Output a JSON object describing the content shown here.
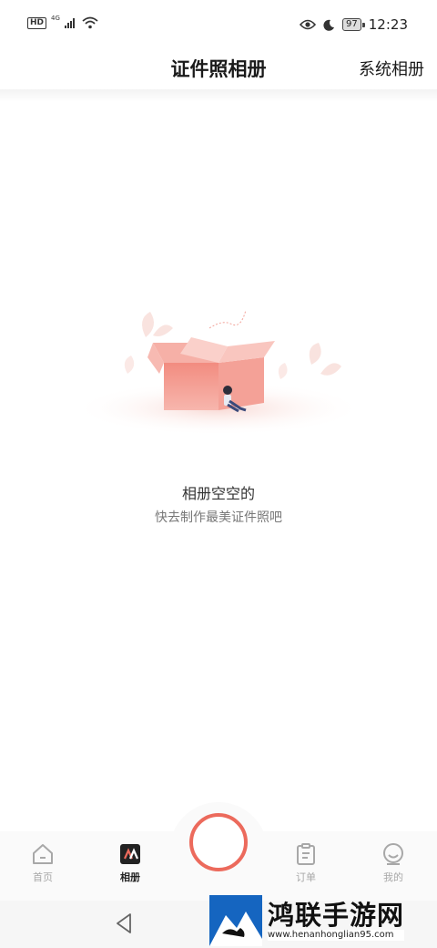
{
  "status_bar": {
    "left_badge": "HD",
    "network": "4G",
    "battery": "97",
    "time": "12:23"
  },
  "header": {
    "title": "证件照相册",
    "right_action": "系统相册"
  },
  "empty_state": {
    "title": "相册空空的",
    "subtitle": "快去制作最美证件照吧"
  },
  "bottom_nav": {
    "items": [
      {
        "label": "首页",
        "icon": "home-icon",
        "active": false
      },
      {
        "label": "相册",
        "icon": "album-icon",
        "active": true
      },
      {
        "label": "订单",
        "icon": "clipboard-icon",
        "active": false
      },
      {
        "label": "我的",
        "icon": "smiley-icon",
        "active": false
      }
    ],
    "capture_button_color": "#ec6a5c"
  },
  "watermark": {
    "name": "鸿联手游网",
    "url": "www.henanhonglian95.com"
  },
  "colors": {
    "accent": "#ec6a5c",
    "inactive": "#a8a8a8"
  }
}
